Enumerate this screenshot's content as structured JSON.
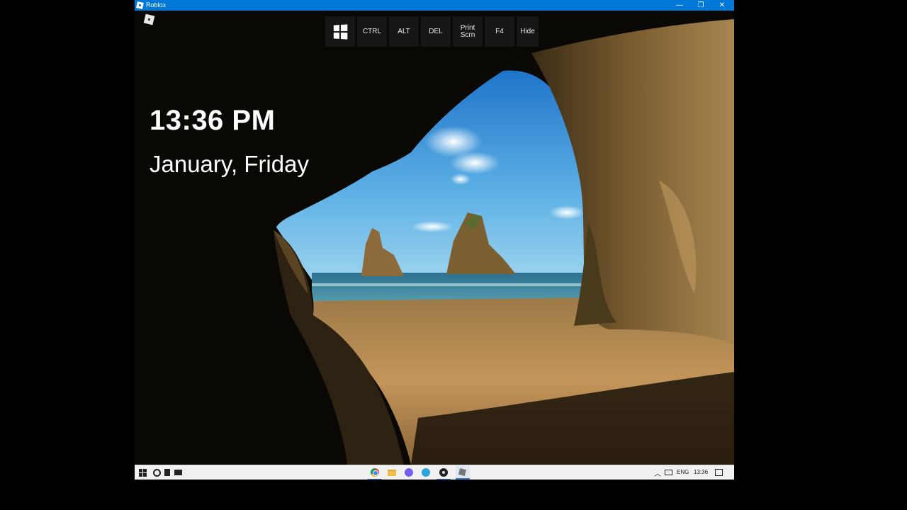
{
  "window": {
    "title": "Roblox",
    "controls": {
      "minimize": "—",
      "maximize": "❐",
      "close": "✕"
    }
  },
  "keybar": {
    "keys": [
      {
        "name": "windows-key",
        "label": ""
      },
      {
        "name": "ctrl-key",
        "label": "CTRL"
      },
      {
        "name": "alt-key",
        "label": "ALT"
      },
      {
        "name": "del-key",
        "label": "DEL"
      },
      {
        "name": "print-screen-key",
        "label": "Print Scrn"
      },
      {
        "name": "f4-key",
        "label": "F4"
      },
      {
        "name": "hide-key",
        "label": "Hide"
      }
    ]
  },
  "lockscreen": {
    "time": "13:36 PM",
    "date": "January, Friday"
  },
  "taskbar": {
    "pinned_left": [
      "windows-start-icon",
      "search-icon",
      "recycle-bin-icon",
      "monitor-icon"
    ],
    "apps": [
      "chrome-icon",
      "file-explorer-icon",
      "viber-icon",
      "telegram-icon",
      "obs-icon",
      "roblox-icon"
    ],
    "tray": {
      "language": "ENG",
      "clock": "13:36"
    }
  },
  "colors": {
    "titlebar": "#0078d7",
    "key_background": "#161616",
    "taskbar": "#f1f1f1"
  }
}
